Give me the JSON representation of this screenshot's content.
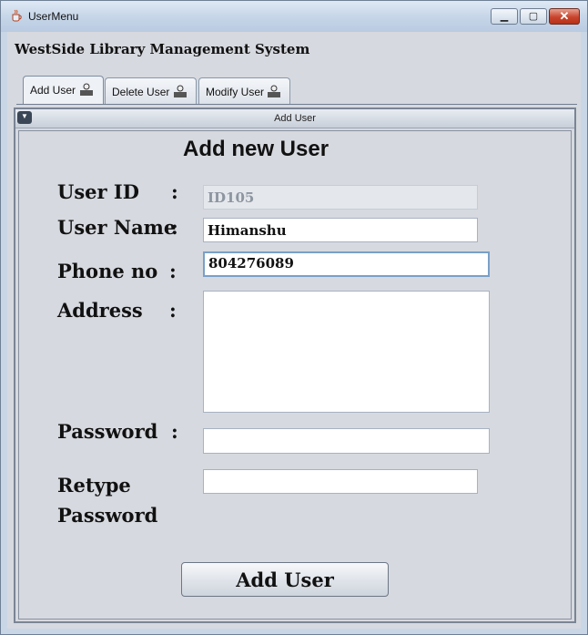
{
  "window": {
    "title": "UserMenu",
    "controls": [
      "minimize",
      "maximize",
      "close"
    ]
  },
  "app_title": "WestSide Library Management System",
  "tabs": [
    {
      "label": "Add User",
      "icon": "user-add-icon",
      "active": true
    },
    {
      "label": "Delete User",
      "icon": "user-delete-icon",
      "active": false
    },
    {
      "label": "Modify User",
      "icon": "user-modify-icon",
      "active": false
    }
  ],
  "frame": {
    "title": "Add User"
  },
  "form": {
    "heading": "Add new User",
    "colon": ":",
    "user_id": {
      "label": "User ID",
      "value": "ID105"
    },
    "user_name": {
      "label": "User Name",
      "value": "Himanshu"
    },
    "phone": {
      "label": "Phone no",
      "value": "804276089"
    },
    "address": {
      "label": "Address",
      "value": ""
    },
    "password": {
      "label": "Password",
      "value": ""
    },
    "retype": {
      "label_line1": "Retype",
      "label_line2": "Password",
      "value": ""
    },
    "submit_label": "Add User"
  },
  "colors": {
    "titlebar": "#c7d6e8",
    "client_bg": "#d6d9df",
    "close_button": "#c8442c",
    "focus_border": "#7aa0c8"
  }
}
